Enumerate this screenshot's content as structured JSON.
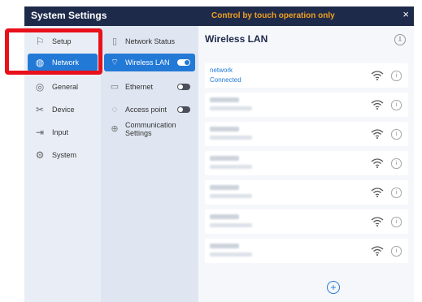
{
  "window": {
    "title": "System Settings",
    "notice": "Control by touch operation only",
    "close_glyph": "×"
  },
  "primary_nav": [
    {
      "label": "Setup",
      "icon": "setup-icon",
      "selected": false
    },
    {
      "label": "Network",
      "icon": "globe-icon",
      "selected": true
    },
    {
      "label": "General",
      "icon": "general-icon",
      "selected": false
    },
    {
      "label": "Device",
      "icon": "tools-icon",
      "selected": false
    },
    {
      "label": "Input",
      "icon": "input-icon",
      "selected": false
    },
    {
      "label": "System",
      "icon": "system-gear-icon",
      "selected": false
    }
  ],
  "secondary_nav": [
    {
      "label": "Network Status",
      "icon": "document-icon",
      "selected": false
    },
    {
      "label": "Wireless LAN",
      "icon": "wifi-icon",
      "selected": true,
      "toggle": true
    },
    {
      "label": "Ethernet",
      "icon": "monitor-icon",
      "selected": false,
      "toggle": false
    },
    {
      "label": "Access point",
      "icon": "access-point-icon",
      "selected": false,
      "toggle": false
    },
    {
      "label": "Communication Settings",
      "label_line1": "Communication",
      "label_line2": "Settings",
      "icon": "globe-icon",
      "selected": false
    }
  ],
  "panel": {
    "title": "Wireless LAN",
    "networks": [
      {
        "name": "network",
        "status": "Connected"
      },
      {
        "name": "",
        "status": ""
      },
      {
        "name": "",
        "status": ""
      },
      {
        "name": "",
        "status": ""
      },
      {
        "name": "",
        "status": ""
      },
      {
        "name": "",
        "status": ""
      },
      {
        "name": "",
        "status": ""
      }
    ]
  },
  "colors": {
    "accent": "#2379d6",
    "titlebar": "#1e2a4a",
    "notice": "#f0a020",
    "highlight": "#e8101a"
  }
}
